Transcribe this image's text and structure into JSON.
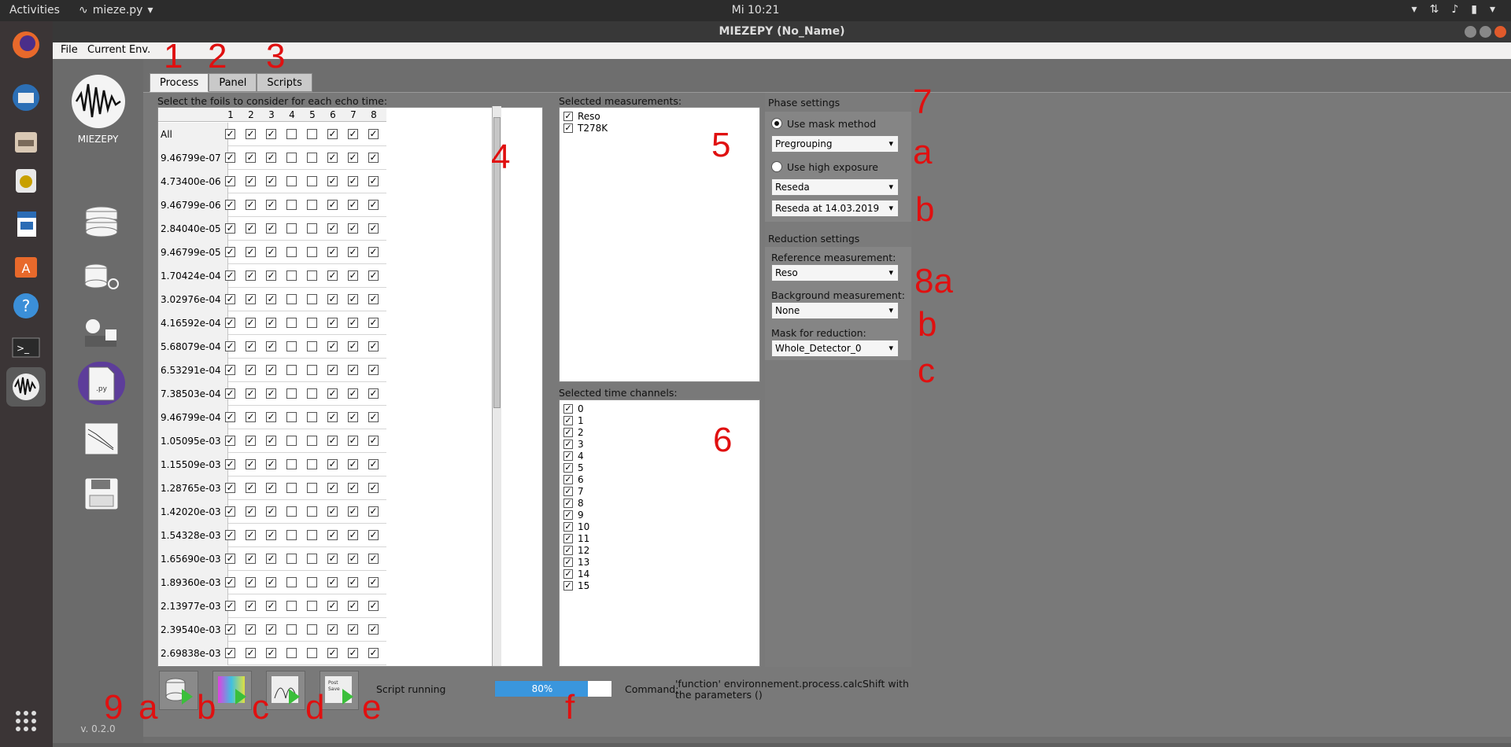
{
  "topbar": {
    "activities": "Activities",
    "app_name": "mieze.py",
    "clock": "Mi 10:21"
  },
  "window": {
    "title": "MIEZEPY (No_Name)"
  },
  "menubar": {
    "file": "File",
    "current_env": "Current Env."
  },
  "sidebar": {
    "logo_label": "MIEZEPY",
    "version": "v. 0.2.0"
  },
  "tabs": [
    {
      "label": "Process"
    },
    {
      "label": "Panel"
    },
    {
      "label": "Scripts"
    }
  ],
  "foils": {
    "title": "Select the foils to consider for each echo time:",
    "columns": [
      "1",
      "2",
      "3",
      "4",
      "5",
      "6",
      "7",
      "8"
    ],
    "checked_pattern": [
      true,
      true,
      true,
      false,
      false,
      true,
      true,
      true
    ],
    "rows": [
      "All",
      "9.46799e-07",
      "4.73400e-06",
      "9.46799e-06",
      "2.84040e-05",
      "9.46799e-05",
      "1.70424e-04",
      "3.02976e-04",
      "4.16592e-04",
      "5.68079e-04",
      "6.53291e-04",
      "7.38503e-04",
      "9.46799e-04",
      "1.05095e-03",
      "1.15509e-03",
      "1.28765e-03",
      "1.42020e-03",
      "1.54328e-03",
      "1.65690e-03",
      "1.89360e-03",
      "2.13977e-03",
      "2.39540e-03",
      "2.69838e-03"
    ]
  },
  "measurements": {
    "title": "Selected measurements:",
    "items": [
      "Reso",
      "T278K"
    ]
  },
  "time_channels": {
    "title": "Selected time channels:",
    "items": [
      "0",
      "1",
      "2",
      "3",
      "4",
      "5",
      "6",
      "7",
      "8",
      "9",
      "10",
      "11",
      "12",
      "13",
      "14",
      "15"
    ]
  },
  "phase": {
    "title": "Phase settings",
    "use_mask": "Use mask method",
    "mask_dropdown": "Pregrouping",
    "use_high_exposure": "Use high exposure",
    "instrument_dropdown": "Reseda",
    "date_dropdown": "Reseda at 14.03.2019"
  },
  "reduction": {
    "title": "Reduction settings",
    "reference_label": "Reference measurement:",
    "reference_value": "Reso",
    "background_label": "Background measurement:",
    "background_value": "None",
    "mask_label": "Mask for reduction:",
    "mask_value": "Whole_Detector_0"
  },
  "bottom": {
    "script_running": "Script running",
    "progress_text": "80%",
    "progress_value": 0.8,
    "command_label": "Command:",
    "command_text": "'function' environnement.process.calcShift with the parameters ()"
  },
  "annotations": {
    "tab1": "1",
    "tab2": "2",
    "tab3": "3",
    "foils": "4",
    "meas": "5",
    "channels": "6",
    "phase": "7",
    "a1": "a",
    "b1": "b",
    "r8a": "8a",
    "rb": "b",
    "rc": "c",
    "n9": "9",
    "ba": "a",
    "bb": "b",
    "bc": "c",
    "bd": "d",
    "be": "e",
    "bf": "f"
  },
  "colors": {
    "annotation": "#e01010",
    "progress": "#3a96dd"
  }
}
